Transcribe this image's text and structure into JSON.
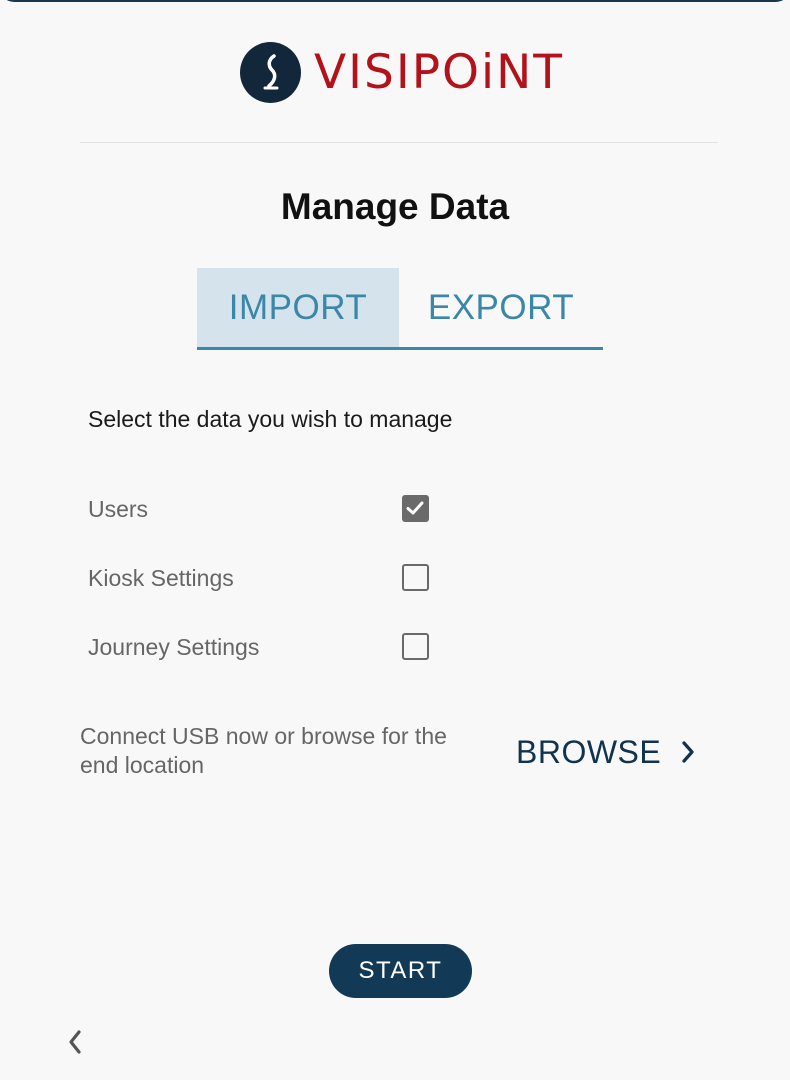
{
  "header": {
    "logo_text": "VISIPOiNT",
    "logo_icon": "visipoint-logo-icon"
  },
  "page": {
    "title": "Manage Data"
  },
  "tabs": [
    {
      "label": "IMPORT",
      "active": true
    },
    {
      "label": "EXPORT",
      "active": false
    }
  ],
  "selection": {
    "instructions": "Select the data you wish to manage",
    "options": [
      {
        "label": "Users",
        "checked": true
      },
      {
        "label": "Kiosk Settings",
        "checked": false
      },
      {
        "label": "Journey Settings",
        "checked": false
      }
    ]
  },
  "location": {
    "text": "Connect USB now or browse for the end location",
    "browse_label": "BROWSE",
    "browse_icon": "chevron-right-icon"
  },
  "actions": {
    "start_label": "START",
    "back_icon": "chevron-left-icon"
  },
  "colors": {
    "brand_red": "#b3121a",
    "navy": "#123a57",
    "tab_accent": "#3b87a8",
    "tab_active_bg": "#d5e3ec"
  }
}
